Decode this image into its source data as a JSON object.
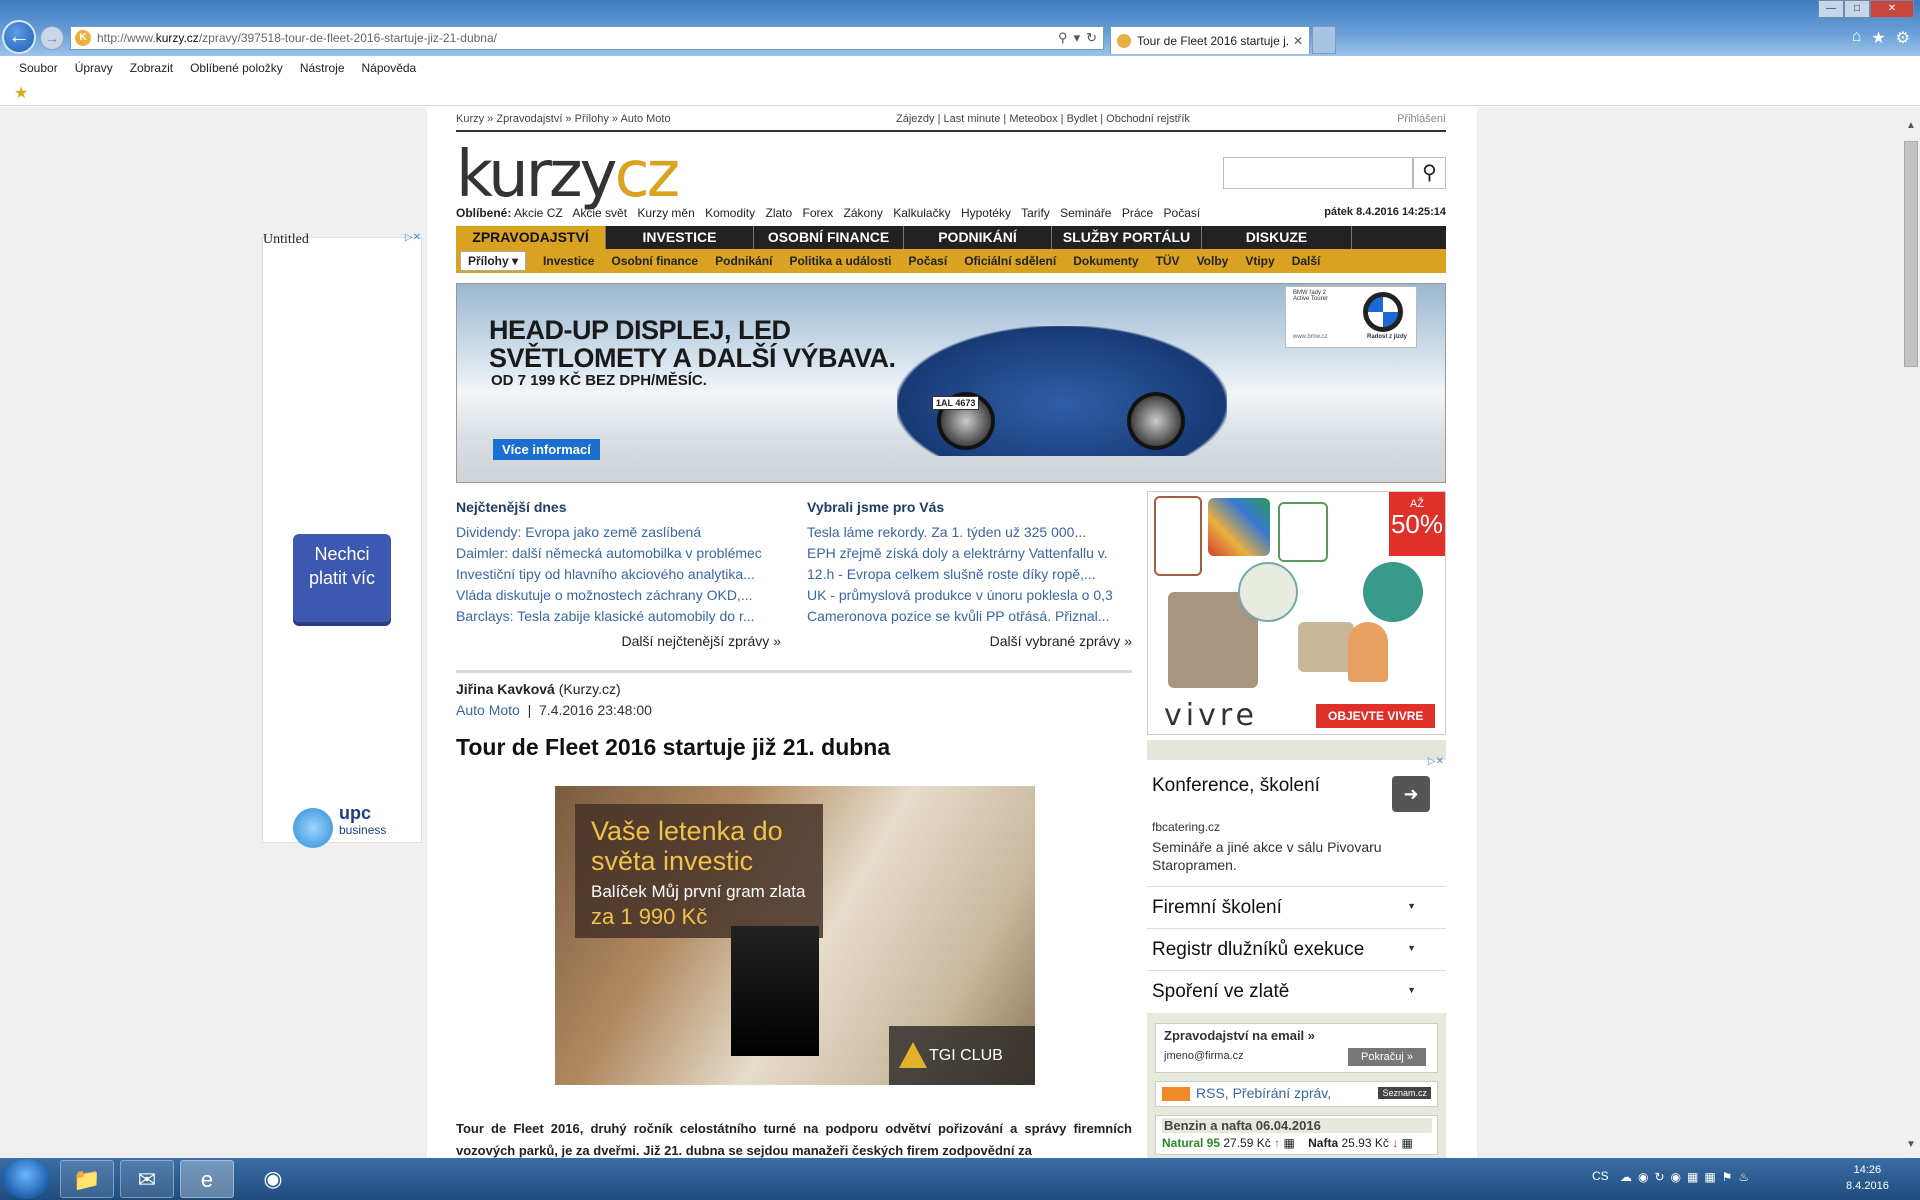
{
  "browser": {
    "url_prefix": "http://www.",
    "url_host": "kurzy.cz",
    "url_path": "/zpravy/397518-tour-de-fleet-2016-startuje-jiz-21-dubna/",
    "tab_title": "Tour de Fleet 2016 startuje j...",
    "menu": [
      "Soubor",
      "Úpravy",
      "Zobrazit",
      "Oblíbené položky",
      "Nástroje",
      "Nápověda"
    ]
  },
  "topbar": {
    "breadcrumb": "Kurzy » Zpravodajství » Přílohy » Auto Moto",
    "links": "Zájezdy | Last minute | Meteobox | Bydlet | Obchodní rejstřík",
    "login": "Přihlášení"
  },
  "logo": {
    "part1": "kurzy",
    "part2": "cz"
  },
  "favorites": {
    "label": "Oblíbené:",
    "items": [
      "Akcie CZ",
      "Akcie svět",
      "Kurzy měn",
      "Komodity",
      "Zlato",
      "Forex",
      "Zákony",
      "Kalkulačky",
      "Hypotéky",
      "Tarify",
      "Semináře",
      "Práce",
      "Počasí"
    ]
  },
  "date": "pátek 8.4.2016 14:25:14",
  "main_nav": [
    "ZPRAVODAJSTVÍ",
    "INVESTICE",
    "OSOBNÍ FINANCE",
    "PODNIKÁNÍ",
    "SLUŽBY PORTÁLU",
    "DISKUZE"
  ],
  "sub_nav": [
    "Přílohy ▾",
    "Investice",
    "Osobní finance",
    "Podnikání",
    "Politika a události",
    "Počasí",
    "Oficiální sdělení",
    "Dokumenty",
    "TÜV",
    "Volby",
    "Vtipy",
    "Další"
  ],
  "banner": {
    "headline_1": "HEAD-UP DISPLEJ, LED",
    "headline_2": "SVĚTLOMETY A DALŠÍ VÝBAVA.",
    "sub": "OD 7 199 KČ BEZ DPH/MĚSÍC.",
    "button": "Více informací",
    "plate": "1AL 4673",
    "bmw_line": "BMW řady 2 Active Tourer",
    "bmw_url": "www.bmw.cz",
    "bmw_claim": "Radost z jízdy"
  },
  "left_ad": {
    "title": "Untitled",
    "button": "Nechci platit víc",
    "brand": "upc",
    "brand_sub": "business"
  },
  "most_read": {
    "title": "Nejčtenější dnes",
    "items": [
      "Dividendy: Evropa jako země zaslíbená",
      "Daimler: další německá automobilka v problémec",
      "Investiční tipy od hlavního akciového analytika...",
      "Vláda diskutuje o možnostech záchrany OKD,...",
      "Barclays: Tesla zabije klasické automobily do r..."
    ],
    "more": "Další nejčtenější zprávy »"
  },
  "picked": {
    "title": "Vybrali jsme pro Vás",
    "items": [
      "Tesla láme rekordy. Za 1. týden už 325 000...",
      "EPH zřejmě získá doly a elektrárny Vattenfallu v.",
      "12.h - Evropa celkem slušně roste díky ropě,...",
      "UK - průmyslová produkce v únoru poklesla o 0,3",
      "Cameronova pozice se kvůli PP otřásá. Přiznal..."
    ],
    "more": "Další vybrané zprávy »"
  },
  "article": {
    "author": "Jiřina Kavková",
    "source": " (Kurzy.cz)",
    "category": "Auto Moto",
    "datetime": "  |  7.4.2016 23:48:00",
    "title": "Tour de Fleet 2016 startuje již 21. dubna",
    "body": "Tour de Fleet 2016, druhý ročník celostátního turné na podporu odvětví pořizování a správy firemních vozových parků, je za dveřmi. Již 21. dubna se sejdou manažeři českých firem zodpovědní za"
  },
  "article_ad": {
    "line1": "Vaše letenka do světa investic",
    "line2": "Balíček Můj první gram zlata",
    "line3": "za 1 990 Kč",
    "brand": "TGI CLUB"
  },
  "right_ad": {
    "sale_top": "AŽ",
    "sale_value": "50%",
    "brand": "vivre",
    "cta": "OBJEVTE VIVRE"
  },
  "conference": {
    "title": "Konference, školení",
    "source": "fbcatering.cz",
    "desc": "Semináře a jiné akce v sálu Pivovaru Staropramen."
  },
  "accordions": [
    "Firemní školení",
    "Registr dlužníků exekuce",
    "Spoření ve zlatě"
  ],
  "newsletter": {
    "title": "Zpravodajství na email »",
    "placeholder": "jmeno@firma.cz",
    "button": "Pokračuj »"
  },
  "rss": {
    "text": "RSS, Přebírání zpráv,",
    "badge": "Seznam.cz"
  },
  "fuel": {
    "title": "Benzin a nafta 06.04.2016",
    "natural_label": "Natural 95",
    "natural_price": "27.59 Kč",
    "diesel_label": "Nafta",
    "diesel_price": "25.93 Kč"
  },
  "taskbar": {
    "lang": "CS",
    "time": "14:26",
    "date": "8.4.2016"
  }
}
